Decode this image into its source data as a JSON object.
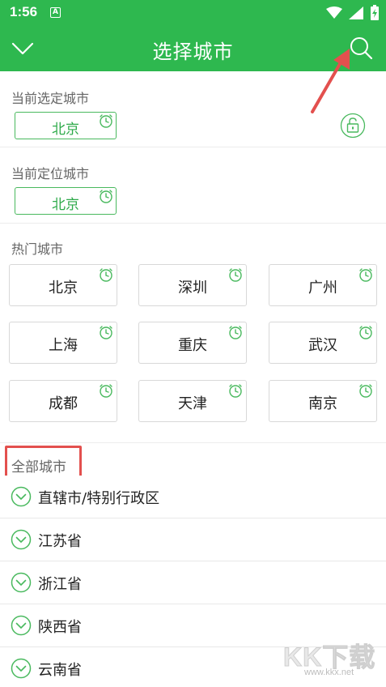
{
  "status_bar": {
    "time": "1:56",
    "notification_letter": "A"
  },
  "app_bar": {
    "title": "选择城市",
    "back_icon": "chevron-down-icon",
    "search_icon": "search-icon"
  },
  "current_selected": {
    "label": "当前选定城市",
    "city": "北京"
  },
  "current_location": {
    "label": "当前定位城市",
    "city": "北京"
  },
  "hot_cities": {
    "label": "热门城市",
    "items": [
      "北京",
      "深圳",
      "广州",
      "上海",
      "重庆",
      "武汉",
      "成都",
      "天津",
      "南京"
    ]
  },
  "all_cities": {
    "label": "全部城市",
    "provinces": [
      "直辖市/特别行政区",
      "江苏省",
      "浙江省",
      "陕西省",
      "云南省"
    ]
  },
  "watermark": {
    "main": "KK下载",
    "url": "www.kkx.net"
  },
  "colors": {
    "primary": "#2eb84f",
    "accent_text": "#2eaa4a",
    "highlight_box": "#e3504e"
  }
}
